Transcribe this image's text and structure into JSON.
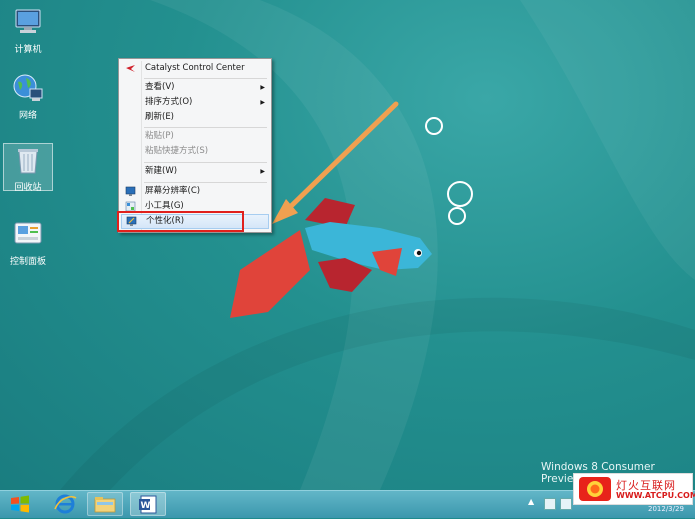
{
  "desktop": {
    "icons": [
      {
        "label": "计算机"
      },
      {
        "label": "网络"
      },
      {
        "label": "回收站"
      },
      {
        "label": "控制面板"
      }
    ],
    "watermark": "Windows 8 Consumer Preview",
    "clock_partial": "2012/3/29"
  },
  "context_menu": {
    "items": [
      {
        "label": "Catalyst Control Center"
      },
      {
        "label": "查看(V)"
      },
      {
        "label": "排序方式(O)"
      },
      {
        "label": "刷新(E)"
      },
      {
        "label": "粘贴(P)"
      },
      {
        "label": "粘贴快捷方式(S)"
      },
      {
        "label": "新建(W)"
      },
      {
        "label": "屏幕分辨率(C)"
      },
      {
        "label": "小工具(G)"
      },
      {
        "label": "个性化(R)"
      }
    ]
  },
  "brand": {
    "name": "灯火互联网",
    "url": "WWW.ATCPU.COM"
  },
  "colors": {
    "highlight": "#e0201c",
    "arrow": "#f0a050",
    "desktop": "#23908f"
  }
}
